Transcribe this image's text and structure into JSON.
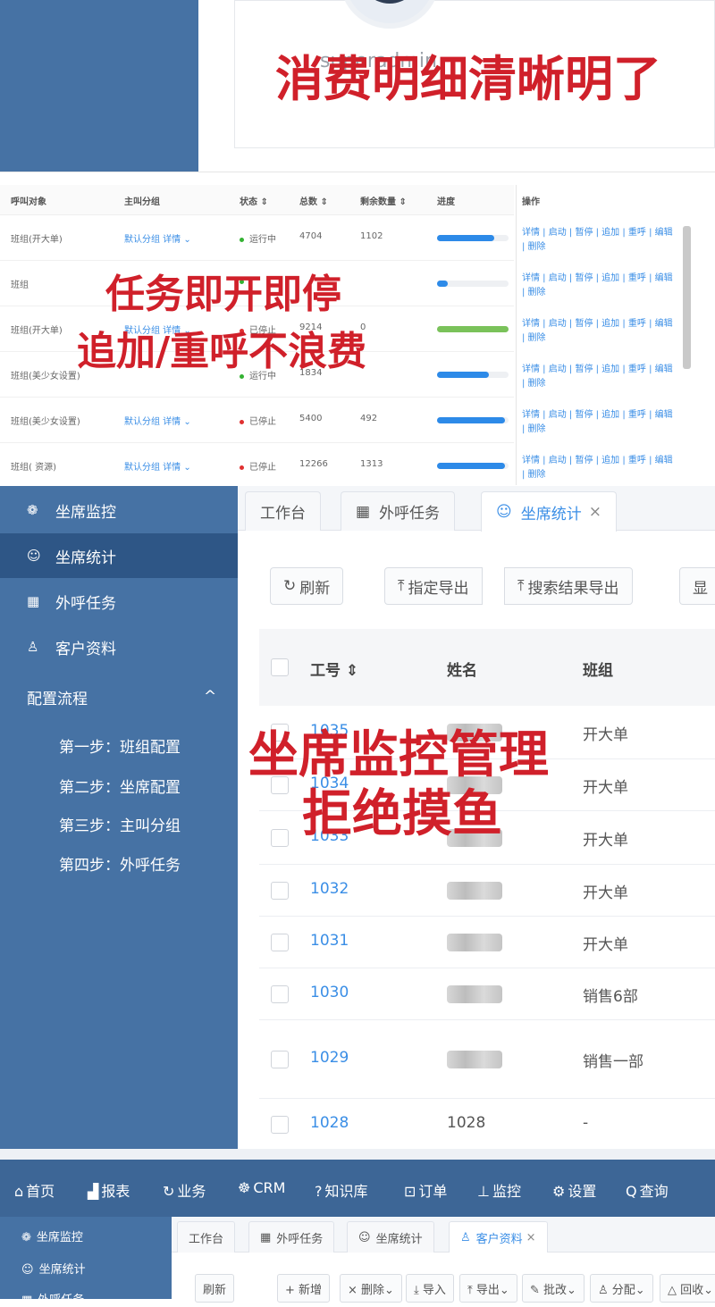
{
  "section1": {
    "username": "superadmin",
    "caption": "消费明细清晰明了"
  },
  "section2": {
    "columns": [
      "呼叫对象",
      "主叫分组",
      "状态 ⇕",
      "总数 ⇕",
      "剩余数量 ⇕",
      "进度",
      "操作"
    ],
    "rows": [
      {
        "target": "班组(开大单)",
        "group": "默认分组 详情 ⌄",
        "status": "运行中",
        "status_color": "#34b233",
        "total": "4704",
        "remaining": "1102",
        "progress": 0.8,
        "bar_color": "#2d8ae8"
      },
      {
        "target": "班组",
        "group": "",
        "status": "",
        "status_color": "#34b233",
        "total": "",
        "remaining": "",
        "progress": 0.15,
        "bar_color": "#2d8ae8"
      },
      {
        "target": "班组(开大单)",
        "group": "默认分组 详情 ⌄",
        "status": "已停止",
        "status_color": "#e03030",
        "total": "9214",
        "remaining": "0",
        "progress": 1.0,
        "bar_color": "#7ac25a"
      },
      {
        "target": "班组(美少女设置)",
        "group": "",
        "status": "运行中",
        "status_color": "#34b233",
        "total": "1834",
        "remaining": "",
        "progress": 0.72,
        "bar_color": "#2d8ae8"
      },
      {
        "target": "班组(美少女设置)",
        "group": "默认分组 详情 ⌄",
        "status": "已停止",
        "status_color": "#e03030",
        "total": "5400",
        "remaining": "492",
        "progress": 0.95,
        "bar_color": "#2d8ae8"
      },
      {
        "target": "班组( 资源)",
        "group": "默认分组 详情 ⌄",
        "status": "已停止",
        "status_color": "#e03030",
        "total": "12266",
        "remaining": "1313",
        "progress": 0.95,
        "bar_color": "#2d8ae8"
      }
    ],
    "ops_line1": "详情 | 启动 | 暂停 | 追加 | 重呼 | 编辑",
    "ops_line2": "| 删除",
    "caption_line1": "任务即开即停",
    "caption_line2": "追加/重呼不浪费"
  },
  "section3": {
    "sidebar": {
      "items": [
        {
          "label": "坐席监控",
          "icon": "❁"
        },
        {
          "label": "坐席统计",
          "icon": "☺"
        },
        {
          "label": "外呼任务",
          "icon": "▦"
        },
        {
          "label": "客户资料",
          "icon": "♙"
        },
        {
          "label": "配置流程",
          "icon": ""
        }
      ],
      "expand_icon": "^",
      "sub_items": [
        "第一步：班组配置",
        "第二步：坐席配置",
        "第三步：主叫分组",
        "第四步：外呼任务"
      ]
    },
    "tabs": [
      {
        "label": "工作台"
      },
      {
        "label": "外呼任务",
        "icon": "▦"
      },
      {
        "label": "坐席统计",
        "icon": "☺",
        "close": "×"
      }
    ],
    "buttons": {
      "refresh": "刷新",
      "export_selected": "指定导出",
      "export_search": "搜索结果导出",
      "more": "显"
    },
    "table_headers": {
      "id": "工号 ⇕",
      "name": "姓名",
      "team": "班组"
    },
    "rows": [
      {
        "id": "1035",
        "name": "",
        "team": "开大单"
      },
      {
        "id": "1034",
        "name": "",
        "team": "开大单"
      },
      {
        "id": "1033",
        "name": "",
        "team": "开大单"
      },
      {
        "id": "1032",
        "name": "",
        "team": "开大单"
      },
      {
        "id": "1031",
        "name": "",
        "team": "开大单"
      },
      {
        "id": "1030",
        "name": "",
        "team": "销售6部"
      },
      {
        "id": "1029",
        "name": "",
        "team": "销售一部"
      },
      {
        "id": "1028",
        "name": "1028",
        "team": "-"
      }
    ],
    "caption_line1": "坐席监控管理",
    "caption_line2": "拒绝摸鱼"
  },
  "section4": {
    "topnav": [
      {
        "label": "首页",
        "icon": "⌂"
      },
      {
        "label": "报表",
        "icon": "▟"
      },
      {
        "label": "业务",
        "icon": "↻"
      },
      {
        "label": "CRM",
        "icon": "☸"
      },
      {
        "label": "知识库",
        "icon": "?"
      },
      {
        "label": "订单",
        "icon": "⊡"
      },
      {
        "label": "监控",
        "icon": "⊥"
      },
      {
        "label": "设置",
        "icon": "⚙"
      },
      {
        "label": "查询",
        "icon": "Q"
      }
    ],
    "sidebar": [
      "坐席监控",
      "坐席统计",
      "外呼任务"
    ],
    "tabs": [
      {
        "label": "工作台"
      },
      {
        "label": "外呼任务"
      },
      {
        "label": "坐席统计"
      },
      {
        "label": "客户资料",
        "close": "×"
      }
    ],
    "buttons": [
      "刷新",
      "+ 新增",
      "× 删除⌄",
      "⤓ 导入",
      "⤒ 导出⌄",
      "✎ 批改⌄",
      "♙ 分配⌄",
      "△ 回收⌄"
    ]
  }
}
